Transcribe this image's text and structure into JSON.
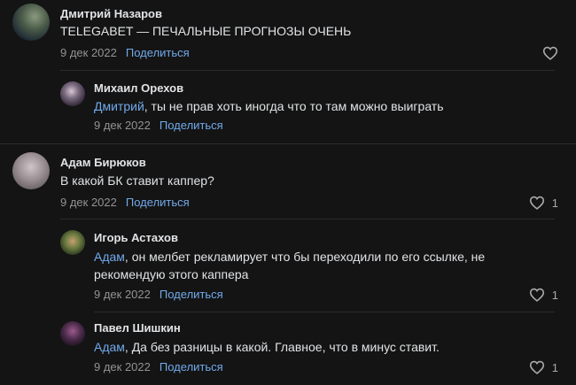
{
  "comments": [
    {
      "author": "Дмитрий Назаров",
      "text": "TELEGABET — ПЕЧАЛЬНЫЕ ПРОГНОЗЫ ОЧЕНЬ",
      "date": "9 дек 2022",
      "share_label": "Поделиться",
      "likes": ""
    },
    {
      "author": "Михаил Орехов",
      "mention": "Дмитрий",
      "text": ", ты не прав хоть иногда что то там можно выиграть",
      "date": "9 дек 2022",
      "share_label": "Поделиться",
      "likes": ""
    },
    {
      "author": "Адам Бирюков",
      "text": "В какой БК ставит каппер?",
      "date": "9 дек 2022",
      "share_label": "Поделиться",
      "likes": "1"
    },
    {
      "author": "Игорь Астахов",
      "mention": "Адам",
      "text": ", он мелбет рекламирует что бы переходили по его ссылке, не",
      "text_line2": "рекомендую этого каппера",
      "date": "9 дек 2022",
      "share_label": "Поделиться",
      "likes": "1"
    },
    {
      "author": "Павел Шишкин",
      "mention": "Адам",
      "text": ", Да без разницы в какой. Главное, что в минус ставит.",
      "date": "9 дек 2022",
      "share_label": "Поделиться",
      "likes": "1"
    }
  ],
  "icons": {
    "like": "heart-outline-icon"
  },
  "colors": {
    "background": "#141414",
    "link": "#71aaeb",
    "text": "#e1e3e6",
    "meta": "#939393"
  }
}
